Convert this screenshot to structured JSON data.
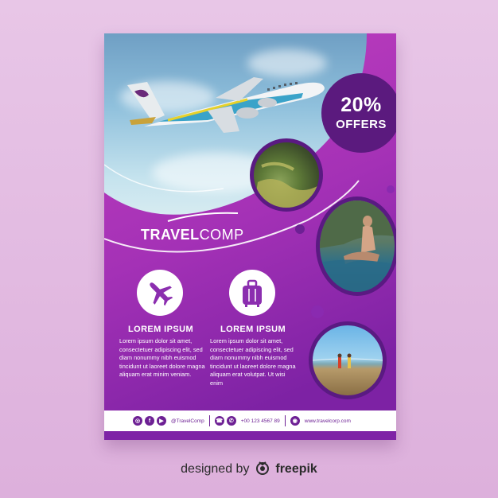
{
  "offer": {
    "percent": "20%",
    "label": "OFFERS"
  },
  "brand": {
    "part1": "TRAVEL",
    "part2": "COMP"
  },
  "columns": [
    {
      "icon": "airplane-icon",
      "title": "LOREM IPSUM",
      "body": "Lorem ipsum dolor sit amet, consectetuer adipiscing elit, sed diam nonummy nibh euismod tincidunt ut laoreet dolore magna aliquam erat minim veniam."
    },
    {
      "icon": "luggage-icon",
      "title": "LOREM IPSUM",
      "body": "Lorem ipsum dolor sit amet, consectetuer adipiscing elit, sed diam nonummy nibh euismod tincidunt ut laoreet dolore magna aliquam erat volutpat. Ut wisi enim"
    }
  ],
  "footer": {
    "social_handle": "@TravelComp",
    "phone": "+00 123 4567 89",
    "website": "www.travelcorp.com"
  },
  "credit": {
    "prefix": "designed by",
    "brand": "freepik"
  },
  "colors": {
    "accent": "#7e22a6",
    "dark": "#5b1a7e",
    "light": "#c43fbe"
  }
}
